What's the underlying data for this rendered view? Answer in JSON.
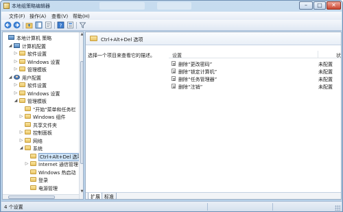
{
  "window": {
    "title": "本地组策略编辑器"
  },
  "titlebar_buttons": {
    "minimize": "–",
    "maximize": "□",
    "close": "✕"
  },
  "menu": [
    "文件(F)",
    "操作(A)",
    "查看(V)",
    "帮助(H)"
  ],
  "toolbar": {
    "icons": [
      "back-arrow-icon",
      "forward-arrow-icon",
      "folder-up-icon",
      "show-hide-tree-icon",
      "export-list-icon",
      "help-icon",
      "properties-view-icon",
      "filter-icon"
    ]
  },
  "tree": {
    "items": [
      {
        "label": "本地计算机 策略",
        "depth": 0,
        "icon": "policy-icon",
        "expander": ""
      },
      {
        "label": "计算机配置",
        "depth": 1,
        "icon": "computer-icon",
        "expander": "◢"
      },
      {
        "label": "软件设置",
        "depth": 2,
        "icon": "folder-icon",
        "expander": "▷"
      },
      {
        "label": "Windows 设置",
        "depth": 2,
        "icon": "folder-icon",
        "expander": "▷"
      },
      {
        "label": "管理模板",
        "depth": 2,
        "icon": "folder-icon",
        "expander": "▷"
      },
      {
        "label": "用户配置",
        "depth": 1,
        "icon": "user-icon",
        "expander": "◢"
      },
      {
        "label": "软件设置",
        "depth": 2,
        "icon": "folder-icon",
        "expander": "▷"
      },
      {
        "label": "Windows 设置",
        "depth": 2,
        "icon": "folder-icon",
        "expander": "▷"
      },
      {
        "label": "管理模板",
        "depth": 2,
        "icon": "folder-icon",
        "expander": "◢"
      },
      {
        "label": "\"开始\"菜单和任务栏",
        "depth": 3,
        "icon": "folder-icon",
        "expander": ""
      },
      {
        "label": "Windows 组件",
        "depth": 3,
        "icon": "folder-icon",
        "expander": "▷"
      },
      {
        "label": "共享文件夹",
        "depth": 3,
        "icon": "folder-icon",
        "expander": ""
      },
      {
        "label": "控制面板",
        "depth": 3,
        "icon": "folder-icon",
        "expander": "▷"
      },
      {
        "label": "网络",
        "depth": 3,
        "icon": "folder-icon",
        "expander": "▷"
      },
      {
        "label": "系统",
        "depth": 3,
        "icon": "folder-icon",
        "expander": "◢"
      },
      {
        "label": "Ctrl+Alt+Del 选项",
        "depth": 4,
        "icon": "folder-icon",
        "expander": "",
        "selected": true
      },
      {
        "label": "Internet 通信管理",
        "depth": 4,
        "icon": "folder-icon",
        "expander": "▷"
      },
      {
        "label": "Windows 热启动",
        "depth": 4,
        "icon": "folder-icon",
        "expander": ""
      },
      {
        "label": "登录",
        "depth": 4,
        "icon": "folder-icon",
        "expander": ""
      },
      {
        "label": "电源管理",
        "depth": 4,
        "icon": "folder-icon",
        "expander": ""
      }
    ]
  },
  "details": {
    "header_title": "Ctrl+Alt+Del 选项",
    "description": "选择一个项目来查看它的描述。",
    "columns": {
      "setting": "设置",
      "state": "状态"
    },
    "rows": [
      {
        "name": "删除“更改密码”",
        "state": "未配置"
      },
      {
        "name": "删除“锁定计算机”",
        "state": "未配置"
      },
      {
        "name": "删除“任务管理器”",
        "state": "未配置"
      },
      {
        "name": "删除“注销”",
        "state": "未配置"
      }
    ],
    "tabs": [
      "扩展",
      "标准"
    ],
    "active_tab": "扩展"
  },
  "status": {
    "text": "4 个设置"
  }
}
